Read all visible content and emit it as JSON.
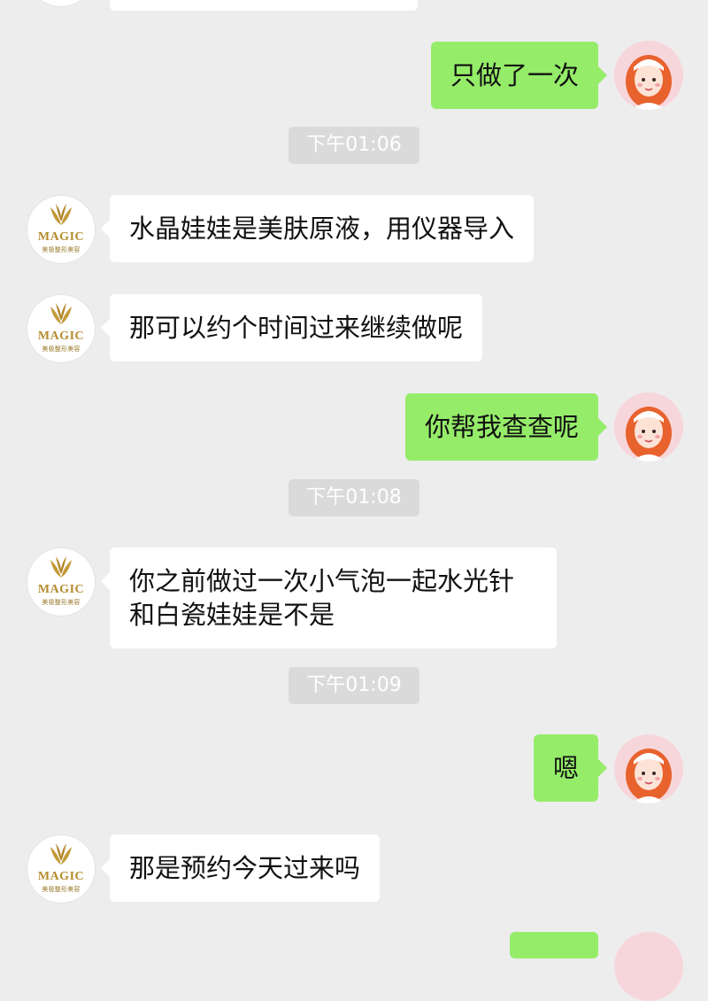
{
  "brand": {
    "logo_text": "MAGIC",
    "logo_subtext": "美极整形美容",
    "colors": {
      "chat_background": "#ededed",
      "incoming_bubble": "#ffffff",
      "outgoing_bubble": "#95ec69",
      "timestamp_pill": "#dadada",
      "logo_gold": "#b48c2e"
    }
  },
  "chat": {
    "messages": {
      "m1": {
        "sender": "self",
        "text": "只做了一次"
      },
      "m2": {
        "sender": "clinic",
        "text": "水晶娃娃是美肤原液，用仪器导入"
      },
      "m3": {
        "sender": "clinic",
        "text": "那可以约个时间过来继续做呢"
      },
      "m4": {
        "sender": "self",
        "text": "你帮我查查呢"
      },
      "m5": {
        "sender": "clinic",
        "text": "你之前做过一次小气泡一起水光针和白瓷娃娃是不是"
      },
      "m6": {
        "sender": "self",
        "text": "嗯"
      },
      "m7": {
        "sender": "clinic",
        "text": "那是预约今天过来吗"
      }
    },
    "timestamps": {
      "t1": "下午01:06",
      "t2": "下午01:08",
      "t3": "下午01:09"
    }
  },
  "icons": {
    "clinic_avatar": "magic-logo-avatar",
    "user_avatar": "cartoon-girl-avatar"
  }
}
